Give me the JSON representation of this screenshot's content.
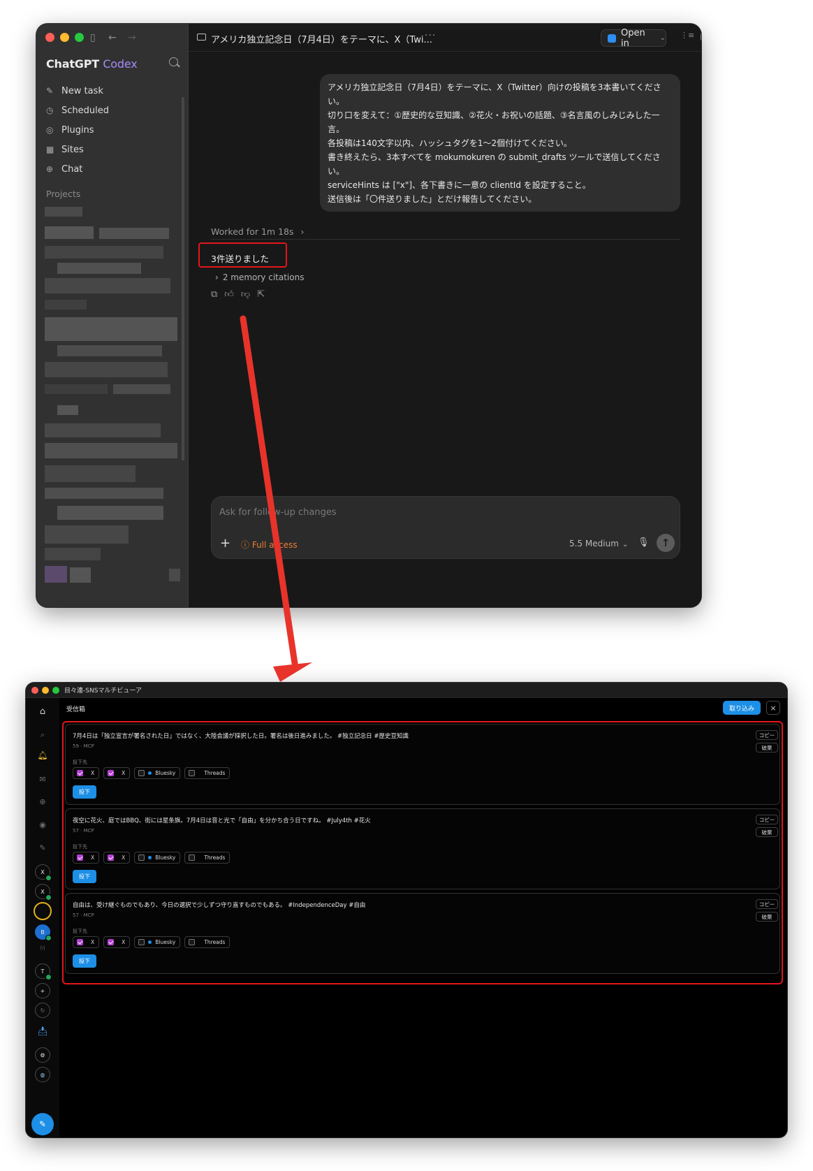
{
  "codex": {
    "brand_main": "ChatGPT",
    "brand_sub": "Codex",
    "nav": [
      {
        "label": "New task",
        "icon": "edit-icon"
      },
      {
        "label": "Scheduled",
        "icon": "clock-icon"
      },
      {
        "label": "Plugins",
        "icon": "plugin-icon"
      },
      {
        "label": "Sites",
        "icon": "grid-icon"
      },
      {
        "label": "Chat",
        "icon": "chat-icon"
      }
    ],
    "projects_label": "Projects",
    "thread_title": "アメリカ独立記念日（7月4日）をテーマに、X（Twi...",
    "more_label": "···",
    "open_in_label": "Open in",
    "prompt_lines": [
      "アメリカ独立記念日（7月4日）をテーマに、X（Twitter）向けの投稿を3本書いてくださ",
      "い。",
      "切り口を変えて：①歴史的な豆知識、②花火・お祝いの話題、③名言風のしみじみした一",
      "言。",
      "各投稿は140文字以内、ハッシュタグを1〜2個付けてください。",
      "書き終えたら、3本すべてを mokumokuren の submit_drafts ツールで送信してくださ",
      "い。",
      "serviceHints は [\"x\"]、各下書きに一意の clientId を設定すること。",
      "送信後は「〇件送りました」とだけ報告してください。"
    ],
    "worked_for": "Worked for 1m 18s",
    "result_text": "3件送りました",
    "memory_citations": "2 memory citations",
    "composer_placeholder": "Ask for follow-up changes",
    "full_access_label": "Full access",
    "model_label": "5.5 Medium"
  },
  "viewer": {
    "window_title": "目々連-SNSマルチビューア",
    "inbox_title": "受信箱",
    "import_button": "取り込み",
    "close_label": "×",
    "dest_label": "投下先",
    "post_button": "投下",
    "copy_button": "コピー",
    "discard_button": "破棄",
    "cards": [
      {
        "text": "7月4日は「独立宣言が署名された日」ではなく、大陸会議が採択した日。署名は後日進みました。 #独立記念日 #歴史豆知識",
        "meta": "59 · MCP",
        "chips": [
          {
            "label": "X",
            "checked": true
          },
          {
            "label": "X",
            "checked": true
          },
          {
            "label": "Bluesky",
            "checked": false
          },
          {
            "label": "Threads",
            "checked": false
          }
        ]
      },
      {
        "text": "夜空に花火、庭ではBBQ、街には星条旗。7月4日は音と光で「自由」を分かち合う日ですね。 #July4th #花火",
        "meta": "57 · MCP",
        "chips": [
          {
            "label": "X",
            "checked": true
          },
          {
            "label": "X",
            "checked": true
          },
          {
            "label": "Bluesky",
            "checked": false
          },
          {
            "label": "Threads",
            "checked": false
          }
        ]
      },
      {
        "text": "自由は、受け継ぐものでもあり、今日の選択で少しずつ守り直すものでもある。 #IndependenceDay #自由",
        "meta": "57 · MCP",
        "chips": [
          {
            "label": "X",
            "checked": true
          },
          {
            "label": "X",
            "checked": true
          },
          {
            "label": "Bluesky",
            "checked": false
          },
          {
            "label": "Threads",
            "checked": false
          }
        ]
      }
    ],
    "rail_avatars": [
      "X",
      "X",
      "",
      "B",
      "T"
    ]
  },
  "colors": {
    "highlight": "#e4161a",
    "accent_blue": "#1d8fe6",
    "codex_purple": "#a78bfa",
    "full_access_orange": "#ef7d33",
    "checkbox_purple": "#b23fd0"
  }
}
